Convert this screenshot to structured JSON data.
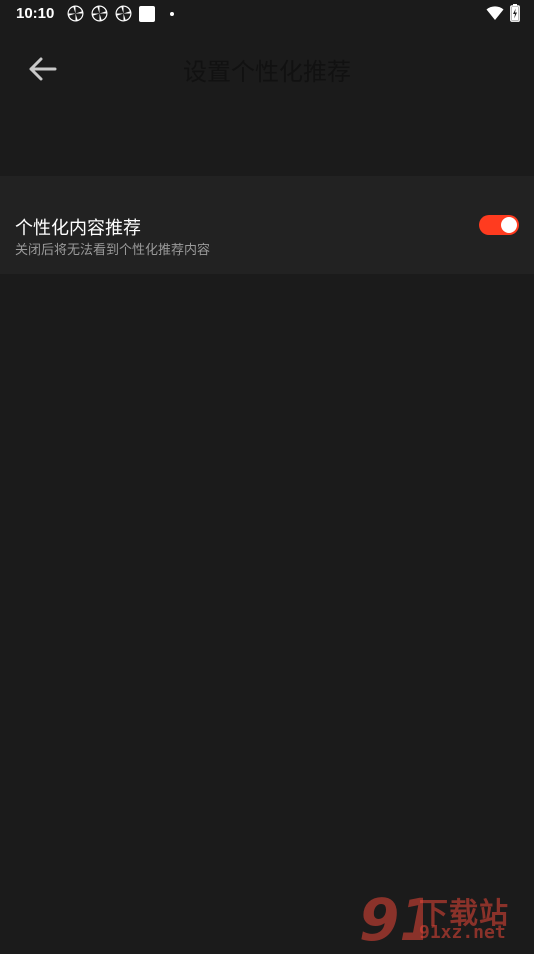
{
  "status_bar": {
    "time": "10:10",
    "notification_icons": [
      "pinwheel-icon",
      "pinwheel-icon",
      "pinwheel-icon",
      "square-app-icon",
      "dot-icon"
    ],
    "right_icons": [
      "wifi-icon",
      "battery-charging-icon"
    ]
  },
  "app_bar": {
    "back_icon": "arrow-left-icon",
    "title": "设置个性化推荐"
  },
  "setting": {
    "title": "个性化内容推荐",
    "subtitle": "关闭后将无法看到个性化推荐内容",
    "enabled": true
  },
  "watermark": {
    "logo_text": "91",
    "top_text": "下载站",
    "bottom_text": "91xz.net"
  },
  "colors": {
    "background": "#1b1b1b",
    "row_background": "#222222",
    "toggle_on": "#ff3b1f",
    "subtitle": "#9a9a9a"
  }
}
